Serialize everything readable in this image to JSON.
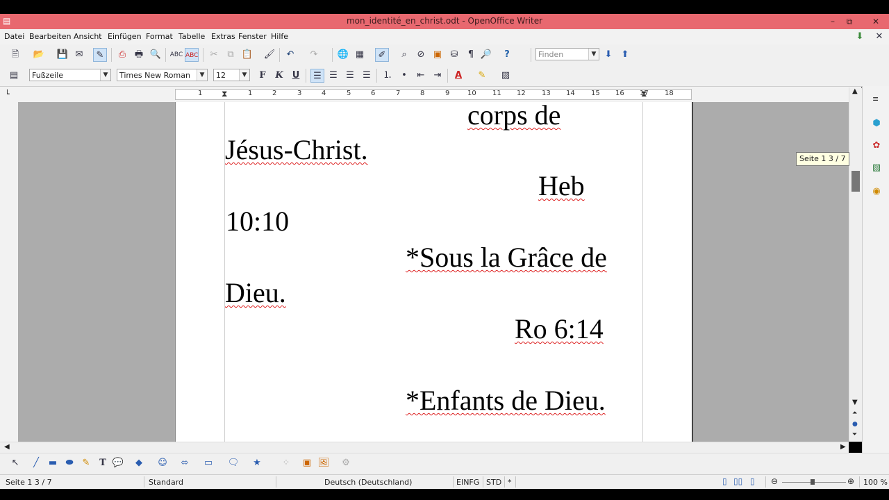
{
  "window": {
    "title": "mon_identité_en_christ.odt - OpenOffice Writer",
    "minimize": "–",
    "restore": "⧉",
    "close": "✕"
  },
  "menu": [
    "Datei",
    "Bearbeiten",
    "Ansicht",
    "Einfügen",
    "Format",
    "Tabelle",
    "Extras",
    "Fenster",
    "Hilfe"
  ],
  "find": {
    "placeholder": "Finden"
  },
  "formatting": {
    "paragraph_style": "Fußzeile",
    "font_name": "Times New Roman",
    "font_size": "12"
  },
  "ruler": {
    "labels": [
      "1",
      "1",
      "2",
      "3",
      "4",
      "5",
      "6",
      "7",
      "8",
      "9",
      "10",
      "11",
      "12",
      "13",
      "14",
      "15",
      "16",
      "17",
      "18"
    ]
  },
  "document": {
    "lines": [
      "corps de",
      "Jésus-Christ.",
      "Heb",
      "10:10",
      "*Sous la Grâce de",
      "Dieu.",
      "Ro 6:14",
      "*Enfants de Dieu."
    ]
  },
  "tooltip": "Seite 1   3 / 7",
  "status": {
    "page": "Seite 1   3 / 7",
    "style": "Standard",
    "language": "Deutsch (Deutschland)",
    "insert_mode": "EINFG",
    "selection_mode": "STD",
    "modified": "*",
    "zoom": "100 %"
  },
  "colors": {
    "titlebar": "#e8686f",
    "page_background": "#acacac",
    "spellcheck": "#d22222"
  }
}
